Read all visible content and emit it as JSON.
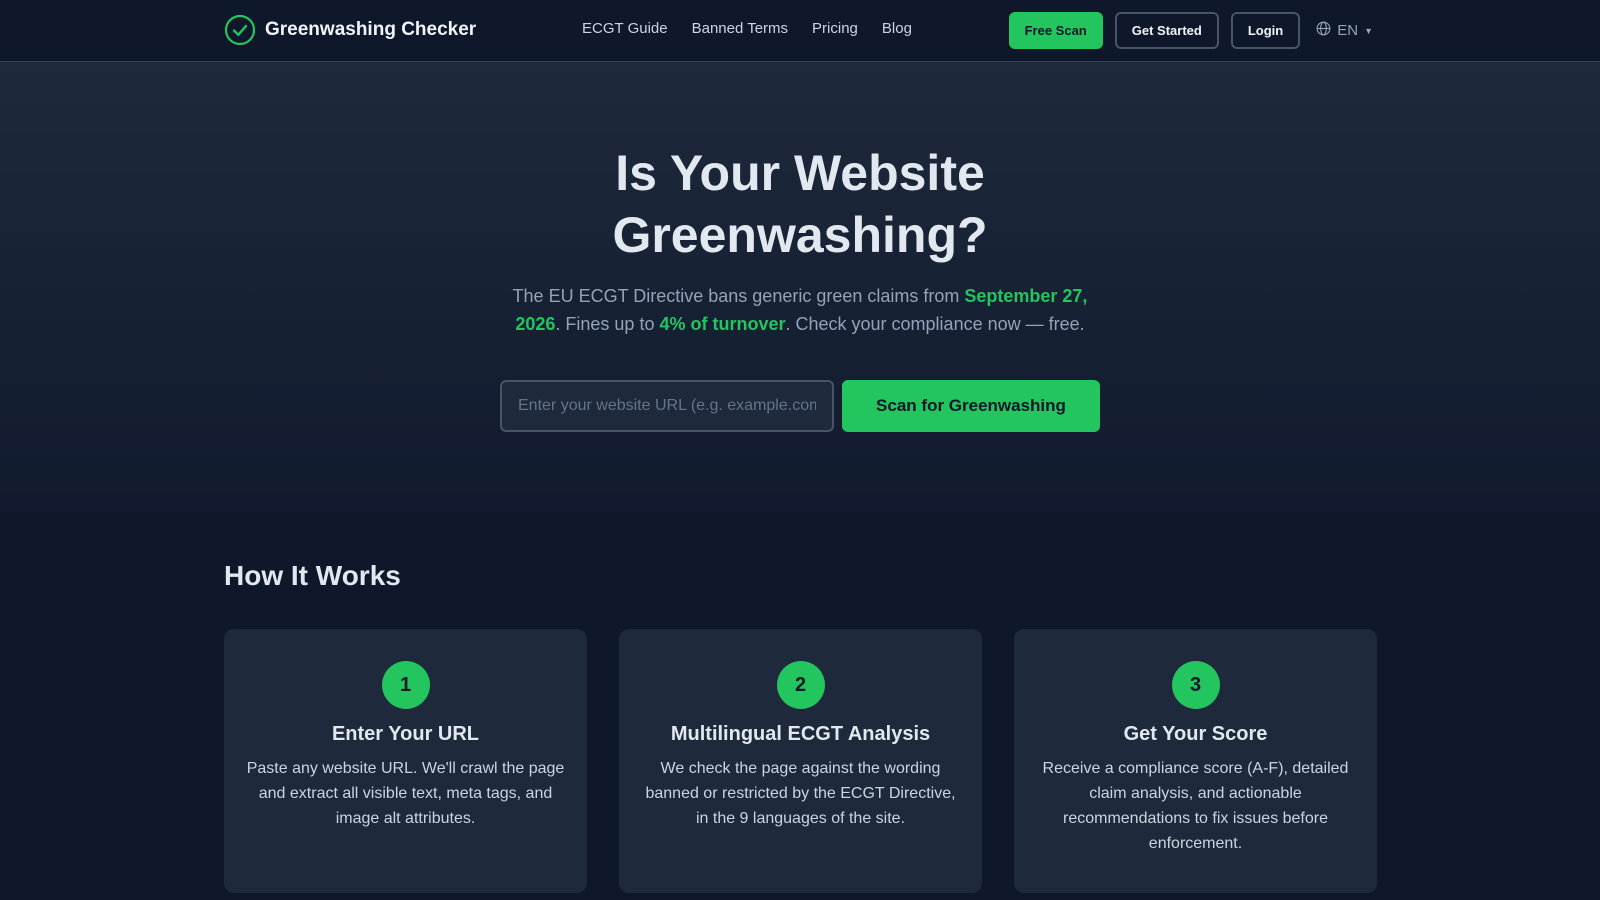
{
  "nav": {
    "brand": "Greenwashing Checker",
    "links": [
      "ECGT Guide",
      "Banned Terms",
      "Pricing",
      "Blog"
    ],
    "free_scan": "Free Scan",
    "get_started": "Get Started",
    "login": "Login",
    "language": "EN",
    "icons": [
      "check-circle-icon",
      "globe-icon",
      "caret-down-icon"
    ]
  },
  "hero": {
    "title_line1": "Is Your Website",
    "title_line2": "Greenwashing?",
    "sub_part1": "The EU ECGT Directive bans generic green claims from ",
    "sub_date": "September 27, 2026",
    "sub_part2": ". Fines up to ",
    "sub_fine": "4% of turnover",
    "sub_part3": ". Check your compliance now — free.",
    "input_placeholder": "Enter your website URL (e.g. example.com)",
    "input_value": "",
    "scan_button": "Scan for Greenwashing"
  },
  "how": {
    "title": "How It Works",
    "steps": [
      {
        "num": "1",
        "title": "Enter Your URL",
        "text": "Paste any website URL. We'll crawl the page and extract all visible text, meta tags, and image alt attributes."
      },
      {
        "num": "2",
        "title": "Multilingual ECGT Analysis",
        "text": "We check the page against the wording banned or restricted by the ECGT Directive, in the 9 languages of the site."
      },
      {
        "num": "3",
        "title": "Get Your Score",
        "text": "Receive a compliance score (A-F), detailed claim analysis, and actionable recommendations to fix issues before enforcement."
      }
    ]
  },
  "colors": {
    "accent": "#22c55e",
    "background": "#0f172a",
    "card": "#1e293b"
  }
}
